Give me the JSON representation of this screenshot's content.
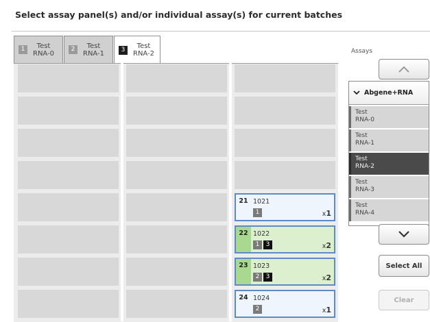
{
  "title": "Select assay panel(s) and/or individual assay(s) for current batches",
  "tabs": [
    {
      "num": "1",
      "line1": "Test",
      "line2": "RNA-0",
      "active": false
    },
    {
      "num": "2",
      "line1": "Test",
      "line2": "RNA-1",
      "active": false
    },
    {
      "num": "3",
      "line1": "Test",
      "line2": "RNA-2",
      "active": true
    }
  ],
  "samples": [
    {
      "pos": "21",
      "id": "1021",
      "badges": [
        "1"
      ],
      "mult_prefix": "x",
      "mult": "1",
      "green": false
    },
    {
      "pos": "22",
      "id": "1022",
      "badges": [
        "1",
        "3"
      ],
      "mult_prefix": "x",
      "mult": "2",
      "green": true
    },
    {
      "pos": "23",
      "id": "1023",
      "badges": [
        "2",
        "3"
      ],
      "mult_prefix": "x",
      "mult": "2",
      "green": true
    },
    {
      "pos": "24",
      "id": "1024",
      "badges": [
        "2"
      ],
      "mult_prefix": "x",
      "mult": "1",
      "green": false
    }
  ],
  "assays": {
    "label": "Assays",
    "panel": "Abgene+RNA",
    "items": [
      {
        "line1": "Test",
        "line2": "RNA-0",
        "selected": false
      },
      {
        "line1": "Test",
        "line2": "RNA-1",
        "selected": false
      },
      {
        "line1": "Test",
        "line2": "RNA-2",
        "selected": true
      },
      {
        "line1": "Test",
        "line2": "RNA-3",
        "selected": false
      },
      {
        "line1": "Test",
        "line2": "RNA-4",
        "selected": false
      }
    ]
  },
  "buttons": {
    "select_all": "Select All",
    "clear": "Clear"
  },
  "icons": {
    "scroll_up": "chevron-up-icon",
    "scroll_down": "chevron-down-icon",
    "panel_expand": "chevron-down-icon"
  },
  "colors": {
    "selected_badge": "#111111",
    "sample_border": "#5a8ac8",
    "sample_green": "#a9d98f"
  }
}
